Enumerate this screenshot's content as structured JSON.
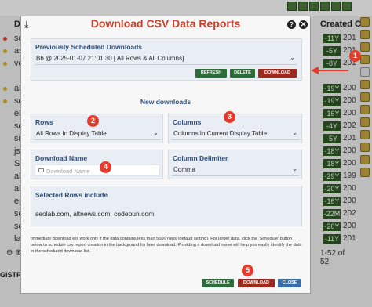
{
  "background": {
    "header_col_do": "Do",
    "header_col_created": "Created C",
    "rows": [
      {
        "name": "sch",
        "badge": "-11Y",
        "year": "201",
        "dot": "#e53b2c"
      },
      {
        "name": "asl",
        "badge": "-5Y",
        "year": "201",
        "dot": "#d8b62a"
      },
      {
        "name": "ve",
        "badge": "-8Y",
        "year": "201",
        "dot": "#d8b62a"
      },
      {
        "name": "",
        "badge": "",
        "year": "",
        "dot": ""
      },
      {
        "name": "ale",
        "badge": "-19Y",
        "year": "200",
        "dot": "#d8b62a"
      },
      {
        "name": "sei",
        "badge": "-19Y",
        "year": "200",
        "dot": "#d8b62a"
      },
      {
        "name": "elg",
        "badge": "-16Y",
        "year": "200",
        "dot": ""
      },
      {
        "name": "sei",
        "badge": "-4Y",
        "year": "202",
        "dot": ""
      },
      {
        "name": "sic",
        "badge": "-5Y",
        "year": "201",
        "dot": ""
      },
      {
        "name": "jsli",
        "badge": "-18Y",
        "year": "200",
        "dot": ""
      },
      {
        "name": "SISTA",
        "badge": "-18Y",
        "year": "200",
        "dot": ""
      },
      {
        "name": "alte",
        "badge": "-29Y",
        "year": "199",
        "dot": ""
      },
      {
        "name": "al",
        "badge": "-20Y",
        "year": "200",
        "dot": ""
      },
      {
        "name": "ep",
        "badge": "-16Y",
        "year": "200",
        "dot": ""
      },
      {
        "name": "se",
        "badge": "-22M",
        "year": "202",
        "dot": ""
      },
      {
        "name": "se",
        "badge": "-20Y",
        "year": "200",
        "dot": ""
      },
      {
        "name": "la",
        "badge": "-11Y",
        "year": "201",
        "dot": ""
      }
    ],
    "pagination": "1-52 of 52",
    "bottom_label": "GISTRAR"
  },
  "modal": {
    "title": "Download CSV Data Reports",
    "previous": {
      "label": "Previously Scheduled Downloads",
      "selected": "Bb @ 2025-01-07 21:01:30 [ All Rows & All Columns]",
      "refresh_label": "REFRESH",
      "delete_label": "DELETE",
      "download_label": "DOWNLOAD"
    },
    "new_downloads_label": "New downloads",
    "rows": {
      "label": "Rows",
      "selected": "All Rows In Display Table"
    },
    "columns": {
      "label": "Columns",
      "selected": "Columns In Current Display Table"
    },
    "download_name": {
      "label": "Download Name",
      "placeholder": "Download Name"
    },
    "column_delimiter": {
      "label": "Column Delimiter",
      "selected": "Comma"
    },
    "selected_rows": {
      "label": "Selected Rows include",
      "value": "seolab.com, altnews.com, codepun.com"
    },
    "info_text": "Immediate download will work only if the data contains less than 5000 rows (default setting). For larger data, click the 'Schedule' button below to schedule csv report creation in the background for later download. Providing a download name will help you easily identify the data in the scheduled download list.",
    "schedule_label": "SCHEDULE",
    "download_label": "DOWNLOAD",
    "close_label": "CLOSE"
  },
  "callouts": [
    "1",
    "2",
    "3",
    "4",
    "5"
  ],
  "colors": {
    "title_red": "#c8402c",
    "callout_red": "#e53b2c",
    "button_red": "#9d2a1f",
    "button_green": "#2e6b3a",
    "label_blue": "#2b4d78"
  }
}
